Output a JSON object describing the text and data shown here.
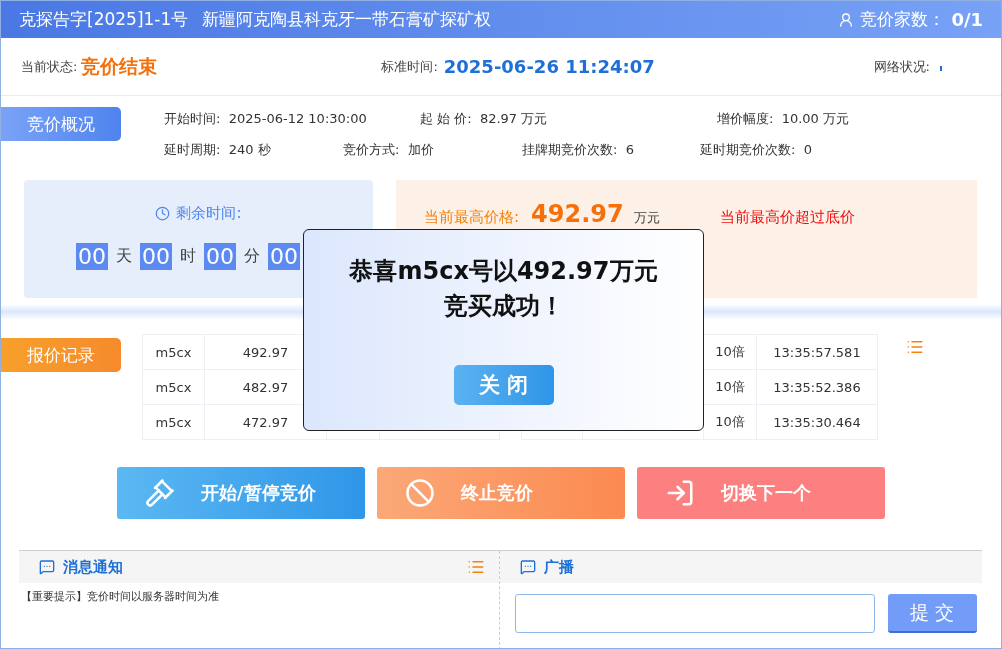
{
  "header": {
    "code": "克探告字[2025]1-1号",
    "title": "新疆阿克陶县科克牙一带石膏矿探矿权",
    "bidders_label": "竞价家数：",
    "bidders": "0/1"
  },
  "status": {
    "state_label": "当前状态:",
    "state": "竞价结束",
    "time_label": "标准时间:",
    "time": "2025-06-26 11:24:07",
    "network_label": "网络状况:"
  },
  "overview": {
    "tag": "竞价概况",
    "rows": [
      [
        {
          "label": "开始时间:",
          "value": "2025-06-12 10:30:00"
        },
        {
          "label": "起 始 价:",
          "value": "82.97 万元"
        },
        "",
        {
          "label": "增价幅度:",
          "value": "10.00 万元"
        }
      ],
      [
        {
          "label": "延时周期:",
          "value": "240 秒"
        },
        {
          "label": "竞价方式:",
          "value": "加价"
        },
        {
          "label": "挂牌期竞价次数:",
          "value": "6"
        },
        {
          "label": "延时期竞价次数:",
          "value": "0"
        }
      ]
    ]
  },
  "countdown": {
    "label": "剩余时间:",
    "parts": [
      {
        "value": "00",
        "unit": "天"
      },
      {
        "value": "00",
        "unit": "时"
      },
      {
        "value": "00",
        "unit": "分"
      },
      {
        "value": "00"
      }
    ]
  },
  "price": {
    "label": "当前最高价格:",
    "value": "492.97",
    "unit": "万元",
    "notice": "当前最高价超过底价"
  },
  "records": {
    "tag": "报价记录",
    "left": [
      {
        "bidder": "m5cx",
        "price": "492.97"
      },
      {
        "bidder": "m5cx",
        "price": "482.97"
      },
      {
        "bidder": "m5cx",
        "price": "472.97"
      }
    ],
    "right": [
      {
        "multiple": "10倍",
        "time": "13:35:57.581"
      },
      {
        "multiple": "10倍",
        "time": "13:35:52.386"
      },
      {
        "multiple": "10倍",
        "time": "13:35:30.464"
      }
    ]
  },
  "actions": [
    {
      "kind": "start",
      "label": "开始/暂停竞价"
    },
    {
      "kind": "stop",
      "label": "终止竞价"
    },
    {
      "kind": "next",
      "label": "切换下一个"
    }
  ],
  "messages": {
    "title": "消息通知",
    "items": [
      "【重要提示】竞价时间以服务器时间为准"
    ]
  },
  "broadcast": {
    "title": "广播",
    "submit": "提 交"
  },
  "modal": {
    "message": "恭喜m5cx号以492.97万元竞买成功！",
    "close": "关 闭"
  }
}
